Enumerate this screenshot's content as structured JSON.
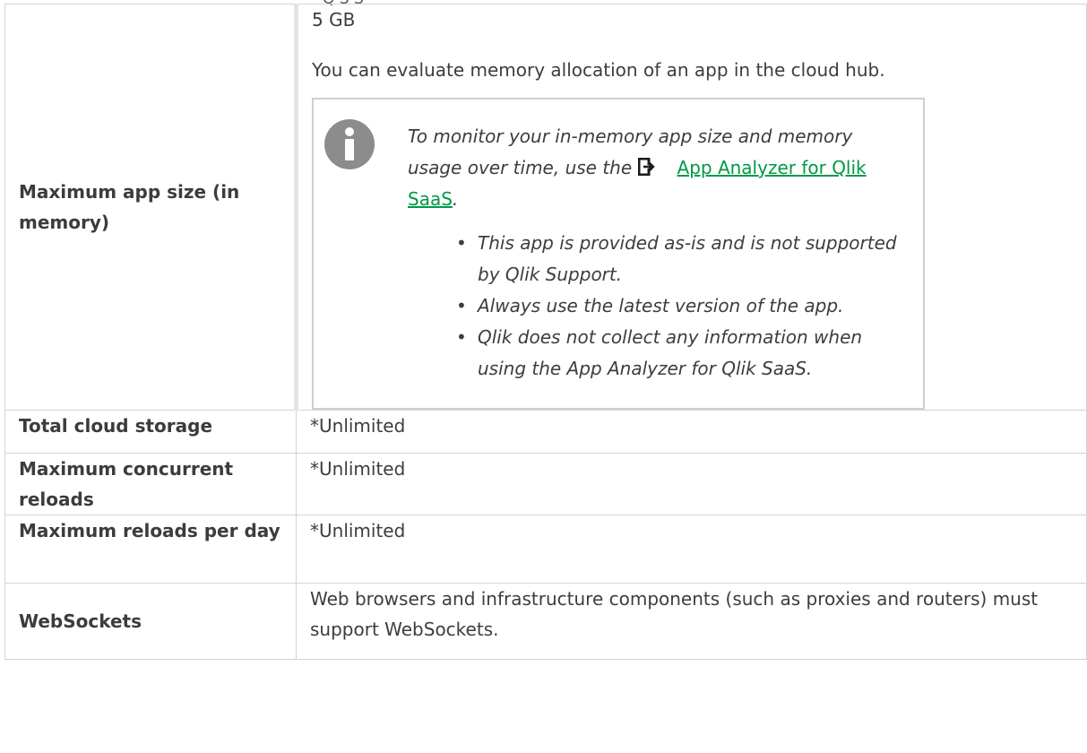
{
  "cutoff_text": "Q   S   S",
  "rows": {
    "app_size": {
      "label": "Maximum app size (in memory)",
      "value": "5 GB",
      "description": "You can evaluate memory allocation of an app in the cloud hub.",
      "note": {
        "text_before": "To monitor your in-memory app size and memory usage over time, use the",
        "link_text": "App Analyzer for Qlik SaaS",
        "text_after": ".",
        "bullets": [
          "This app is provided as-is and is not supported by Qlik Support.",
          "Always use the latest version of the app.",
          "Qlik does not collect any information when using the App Analyzer for Qlik SaaS."
        ]
      }
    },
    "storage": {
      "label": "Total cloud storage",
      "value": "*Unlimited"
    },
    "concurrent": {
      "label": "Maximum concurrent reloads",
      "value": "*Unlimited"
    },
    "reloads_per_day": {
      "label": "Maximum reloads per day",
      "value": "*Unlimited"
    },
    "websockets": {
      "label": "WebSockets",
      "value": "Web browsers and infrastructure components (such as proxies and routers) must support WebSockets."
    }
  },
  "colors": {
    "link": "#009845",
    "border": "#d4d4d4",
    "icon": "#8c8c8c"
  },
  "icons": {
    "note": "info-icon",
    "link": "external-link-icon"
  }
}
